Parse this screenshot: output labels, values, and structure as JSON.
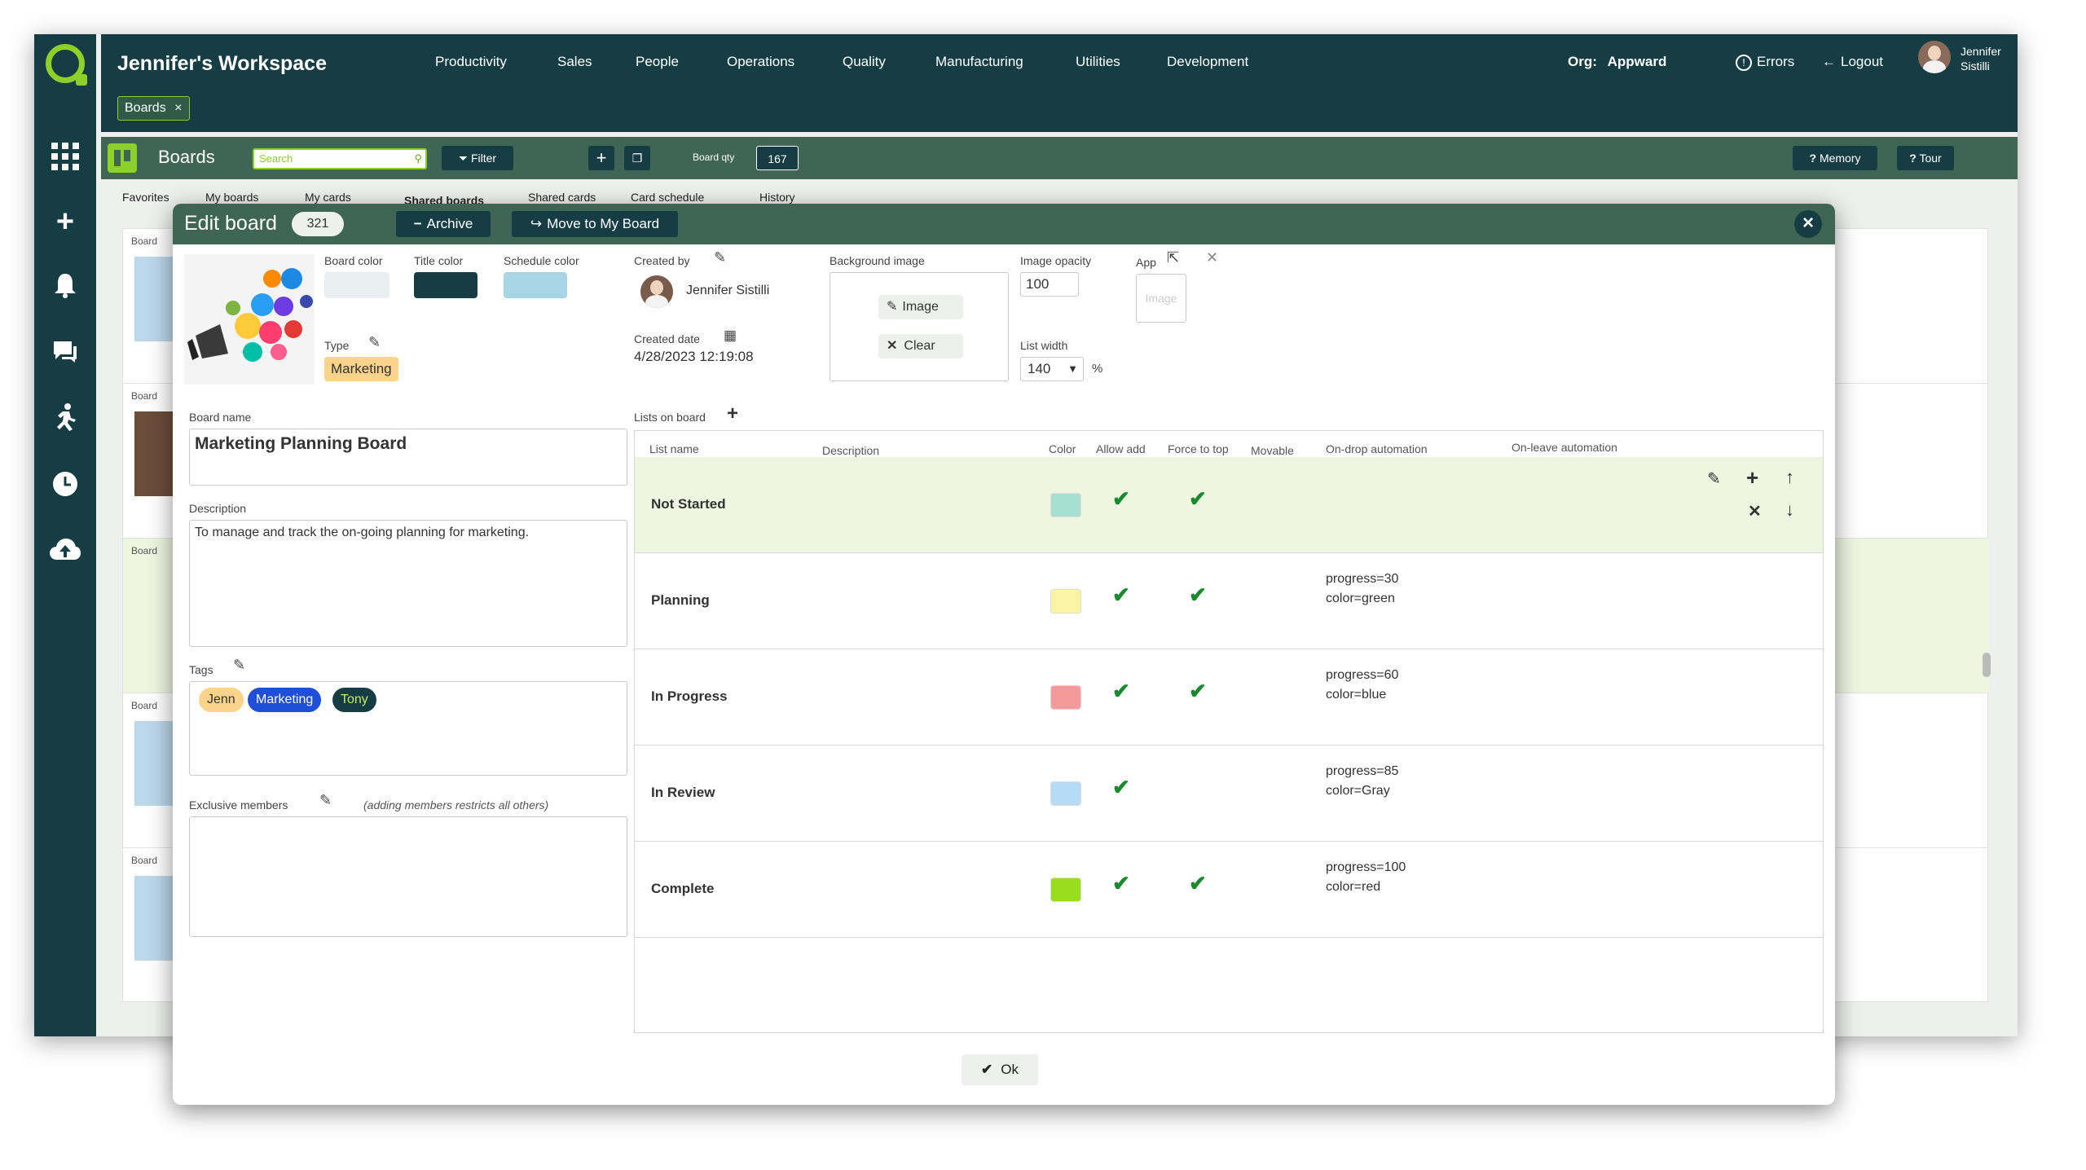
{
  "workspace": {
    "title": "Jennifer's Workspace"
  },
  "menu": [
    "Productivity",
    "Sales",
    "People",
    "Operations",
    "Quality",
    "Manufacturing",
    "Utilities",
    "Development"
  ],
  "org": {
    "label": "Org:",
    "name": "Appward"
  },
  "top_right": {
    "errors": "Errors",
    "logout": "Logout",
    "user_first": "Jennifer",
    "user_last": "Sistilli"
  },
  "breadcrumb_chip": {
    "label": "Boards",
    "close": "×"
  },
  "boards_bar": {
    "title": "Boards",
    "search_placeholder": "Search",
    "filter": "Filter",
    "board_qty_label": "Board qty",
    "board_qty": "167",
    "memory": "Memory",
    "tour": "Tour"
  },
  "subtabs": [
    "Favorites",
    "My boards",
    "My cards",
    "Shared boards",
    "Shared cards",
    "Card schedule",
    "History"
  ],
  "bg_board_labels": [
    "Board",
    "Board",
    "Board",
    "Board",
    "Board"
  ],
  "modal": {
    "title": "Edit board",
    "board_id": "321",
    "archive": "Archive",
    "move": "Move to My Board",
    "close": "×",
    "board_color_label": "Board color",
    "title_color_label": "Title color",
    "schedule_color_label": "Schedule color",
    "colors": {
      "board": "#e9eff1",
      "title": "#173d44",
      "schedule": "#a9d6e6"
    },
    "type_label": "Type",
    "type_value": "Marketing",
    "created_by_label": "Created by",
    "created_by": "Jennifer Sistilli",
    "created_date_label": "Created date",
    "created_date": "4/28/2023 12:19:08",
    "bg_image_label": "Background image",
    "image_btn": "Image",
    "clear_btn": "Clear",
    "opacity_label": "Image opacity",
    "opacity_value": "100",
    "list_width_label": "List width",
    "list_width_value": "140",
    "percent": "%",
    "app_label": "App",
    "app_image_placeholder": "Image",
    "board_name_label": "Board name",
    "board_name": "Marketing Planning Board",
    "description_label": "Description",
    "description": "To manage and track the on-going planning for marketing.",
    "tags_label": "Tags",
    "tags": [
      {
        "text": "Jenn",
        "bg": "#fbd38a",
        "fg": "#333"
      },
      {
        "text": "Marketing",
        "bg": "#1f4fd8",
        "fg": "#fff"
      },
      {
        "text": "Tony",
        "bg": "#173d44",
        "fg": "#c6e86c"
      }
    ],
    "exclusive_label": "Exclusive members",
    "exclusive_note": "(adding members restricts all others)",
    "lists_label": "Lists on board",
    "ok": "Ok"
  },
  "lists_table": {
    "headers": [
      "List name",
      "Description",
      "Color",
      "Allow add",
      "Force to top",
      "Movable",
      "On-drop automation",
      "On-leave automation"
    ],
    "rows": [
      {
        "name": "Not Started",
        "color": "#a8e0cf",
        "allow_add": "✔",
        "force_top": "✔",
        "auto1": "",
        "auto2": ""
      },
      {
        "name": "Planning",
        "color": "#fbf4a6",
        "allow_add": "✔",
        "force_top": "✔",
        "auto1": "progress=30",
        "auto2": "color=green"
      },
      {
        "name": "In Progress",
        "color": "#f49a9a",
        "allow_add": "✔",
        "force_top": "✔",
        "auto1": "progress=60",
        "auto2": "color=blue"
      },
      {
        "name": "In Review",
        "color": "#b6dcf5",
        "allow_add": "✔",
        "force_top": "",
        "auto1": "progress=85",
        "auto2": "color=Gray"
      },
      {
        "name": "Complete",
        "color": "#9ade1b",
        "allow_add": "✔",
        "force_top": "✔",
        "auto1": "progress=100",
        "auto2": "color=red"
      }
    ]
  }
}
